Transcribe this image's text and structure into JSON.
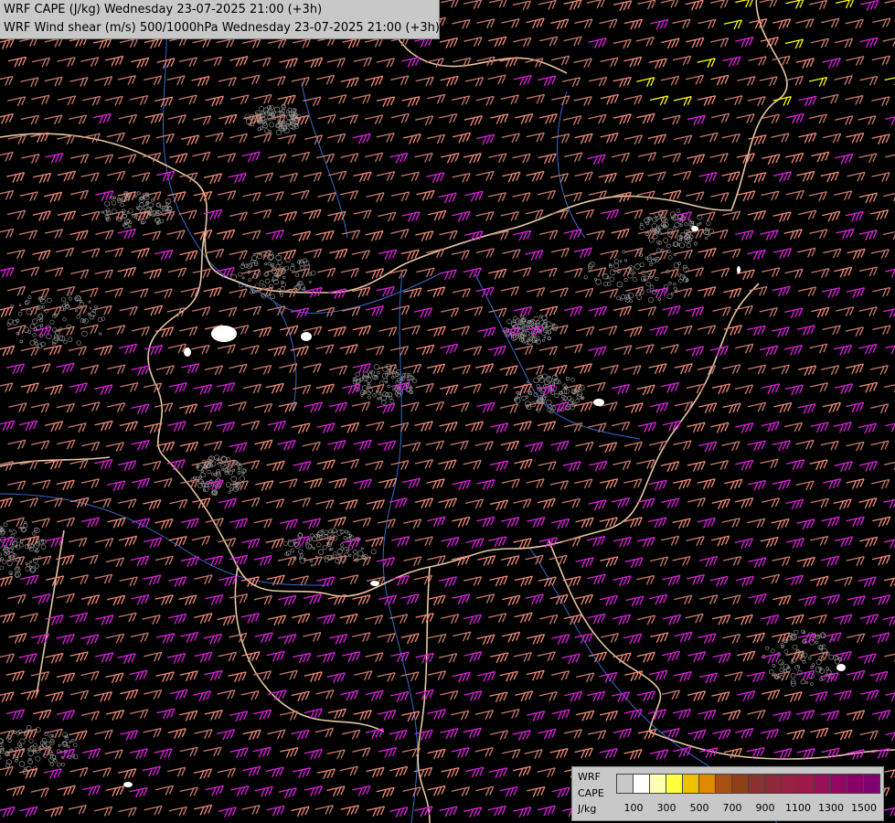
{
  "map": {
    "titles": [
      "WRF CAPE (J/kg) Wednesday 23-07-2025 21:00 (+3h)",
      "WRF Wind shear (m/s) 500/1000hPa Wednesday 23-07-2025 21:00 (+3h)"
    ],
    "background_color": "#000000",
    "barb_colors": {
      "weak": "#c87a6e",
      "moderate": "#f08a78",
      "strong": "#e020e0",
      "very_strong": "#ffff00"
    },
    "border_color": "#e8c8a0",
    "river_color": "#3a6ac8",
    "cape_contour_color": "#a0a0a0"
  },
  "legend": {
    "label_lines": [
      "WRF",
      "CAPE",
      "J/kg"
    ],
    "colors": [
      "#ffffff",
      "#ffffb0",
      "#ffff40",
      "#f0c000",
      "#e08800",
      "#a85010",
      "#904018",
      "#8c3030",
      "#902838",
      "#982040",
      "#a01848",
      "#981058",
      "#900860",
      "#880068",
      "#800070"
    ],
    "tick_labels": [
      "100",
      "300",
      "500",
      "700",
      "900",
      "1100",
      "1300",
      "1500"
    ]
  }
}
